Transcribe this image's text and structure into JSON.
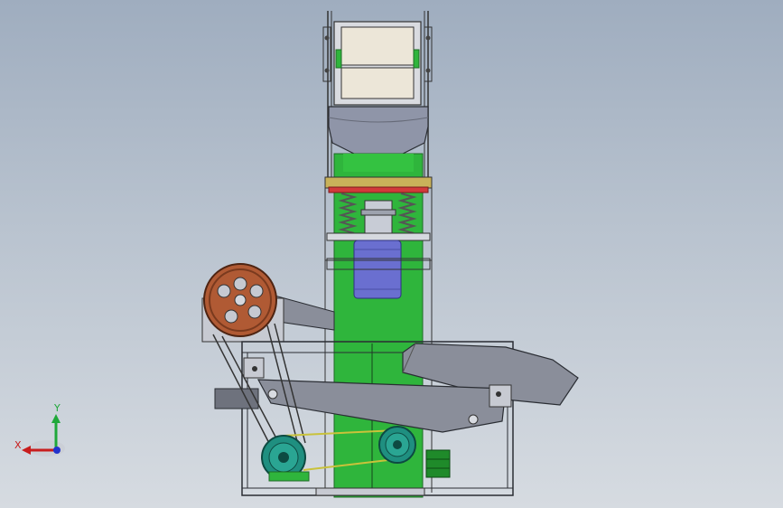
{
  "viewport": {
    "background_top": "#9fadbf",
    "background_bottom": "#d6dbe1"
  },
  "colors": {
    "green_body": "#2fb53c",
    "green_dark": "#1f8a2a",
    "pulley_brown": "#b05a34",
    "pulley_teal": "#1f8f80",
    "motor_blue": "#6a6fd0",
    "hopper_gray": "#8f95a8",
    "linkage_gray": "#8a8e9a",
    "frame_line": "#2a2d33",
    "screen_beige": "#ece6d8",
    "spring_red": "#d23a3a"
  },
  "triad": {
    "x_label": "X",
    "y_label": "Y",
    "x_color": "#c81d1d",
    "y_color": "#1fa83a",
    "z_color": "#2233cc"
  }
}
